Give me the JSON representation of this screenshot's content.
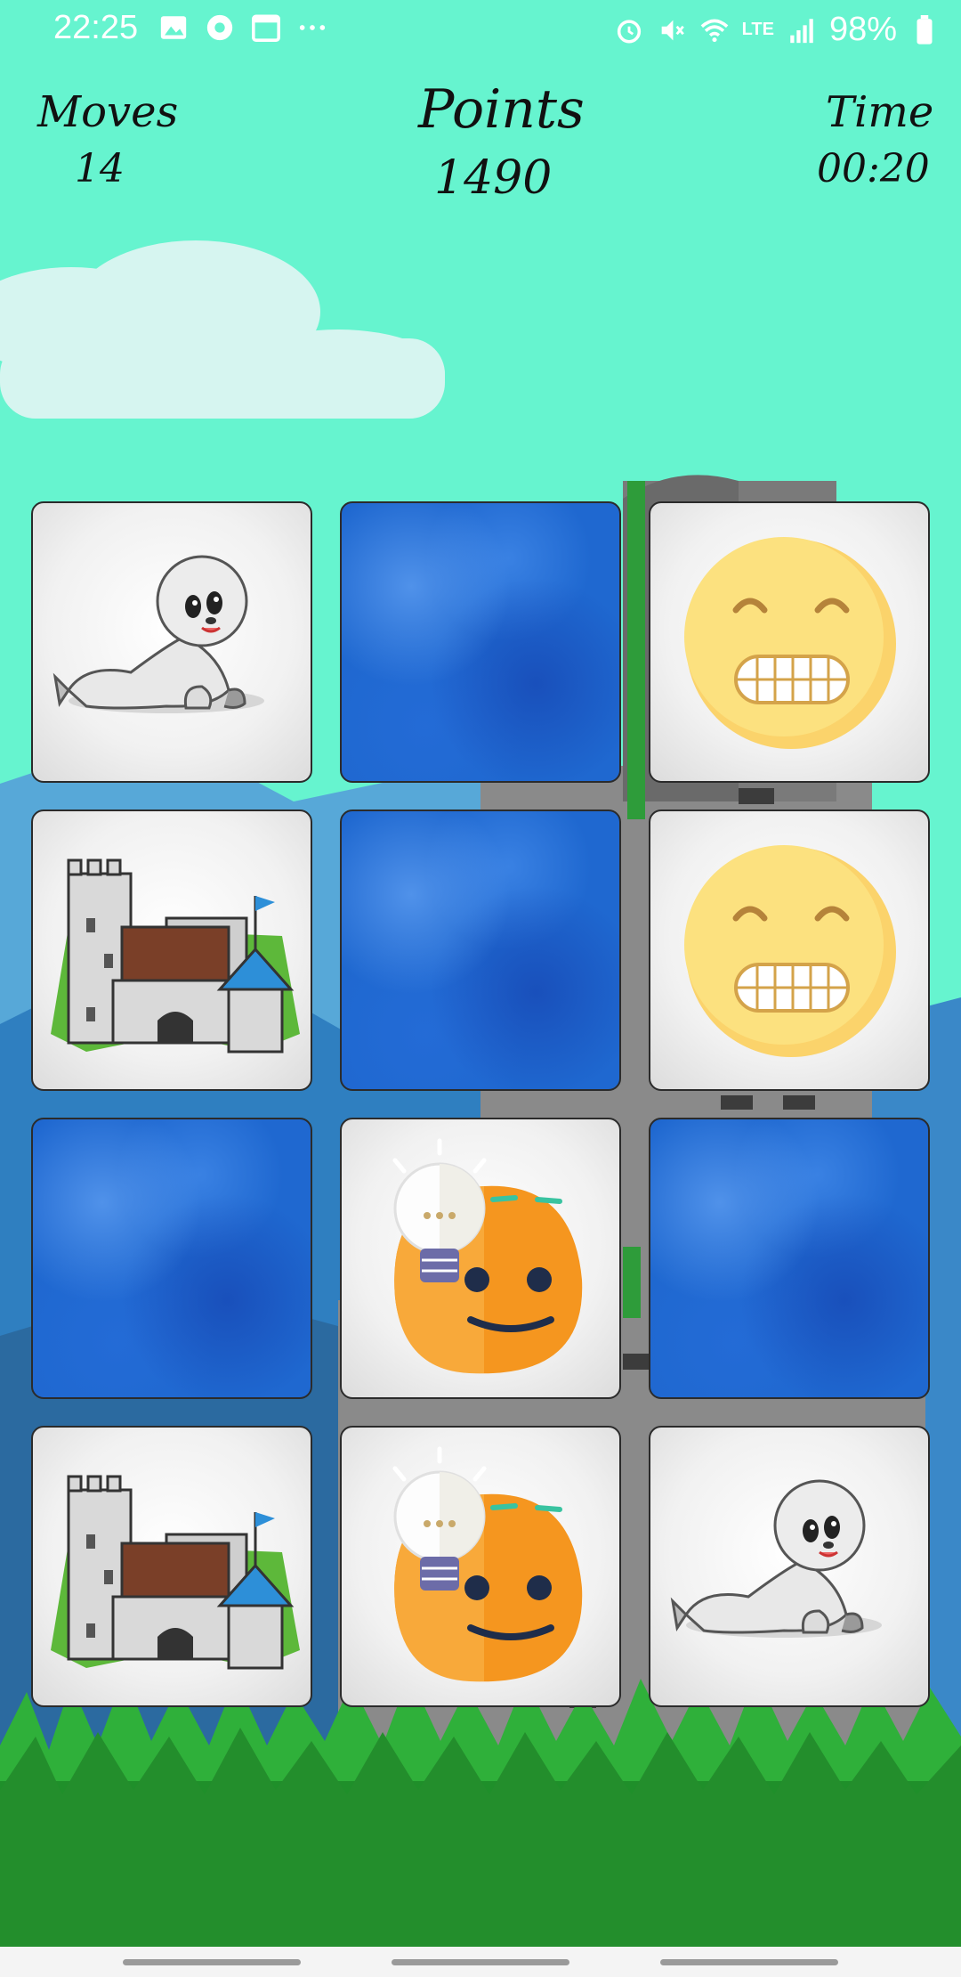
{
  "status_bar": {
    "time": "22:25",
    "battery": "98%",
    "network": "LTE",
    "icons_left": [
      "gallery-icon",
      "app-icon",
      "calendar-icon",
      "more-icon"
    ],
    "icons_right": [
      "alarm-icon",
      "mute-icon",
      "wifi-icon",
      "lte-icon",
      "signal-icon",
      "battery-icon"
    ]
  },
  "hud": {
    "moves_label": "Moves",
    "moves_value": "14",
    "points_label": "Points",
    "points_value": "1490",
    "time_label": "Time",
    "time_value": "00:20"
  },
  "board": {
    "rows": 4,
    "cols": 3,
    "cards": [
      {
        "state": "face-up",
        "image": "seal"
      },
      {
        "state": "face-down",
        "image": null
      },
      {
        "state": "face-up",
        "image": "grin-emoji"
      },
      {
        "state": "face-up",
        "image": "castle"
      },
      {
        "state": "face-down",
        "image": null
      },
      {
        "state": "face-up",
        "image": "grin-emoji"
      },
      {
        "state": "face-down",
        "image": null
      },
      {
        "state": "face-up",
        "image": "idea-emoji"
      },
      {
        "state": "face-down",
        "image": null
      },
      {
        "state": "face-up",
        "image": "castle"
      },
      {
        "state": "face-up",
        "image": "idea-emoji"
      },
      {
        "state": "face-up",
        "image": "seal"
      }
    ]
  },
  "colors": {
    "sky": "#66f4cf",
    "card_back": "#1f68d0",
    "grass": "#1e9a2a"
  }
}
